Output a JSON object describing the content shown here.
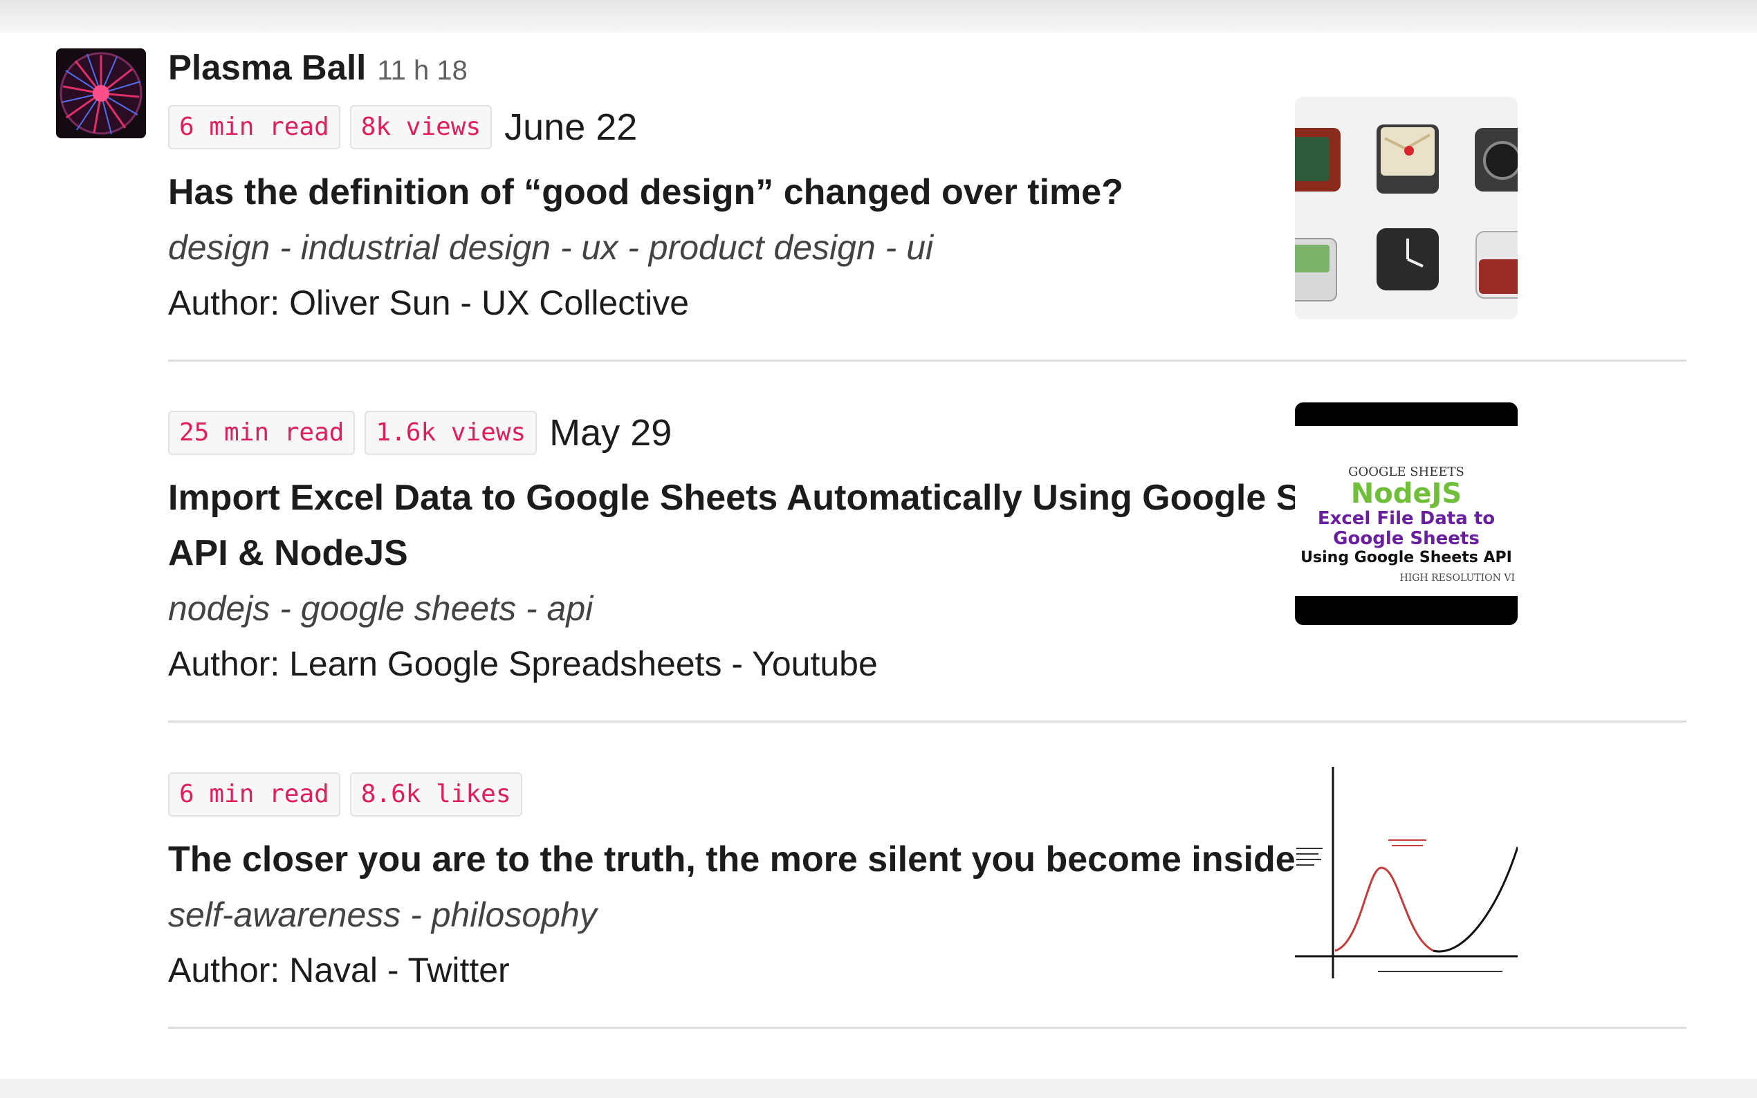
{
  "message": {
    "sender": "Plasma Ball",
    "timestamp": "11 h 18"
  },
  "articles": [
    {
      "read_time": "6 min read",
      "stat": "8k views",
      "date": "June 22",
      "title": "Has the definition of “good design” changed over time?",
      "tags": "design - industrial design - ux - product design - ui",
      "author": "Author: Oliver Sun - UX Collective",
      "thumbnail_icon": "retro-device-icons-thumbnail"
    },
    {
      "read_time": "25 min read",
      "stat": "1.6k views",
      "date": "May 29",
      "title": "Import Excel Data to Google Sheets Automatically Using Google Sheets API & NodeJS",
      "tags": "nodejs - google sheets - api",
      "author": "Author: Learn Google Spreadsheets - Youtube",
      "thumbnail": {
        "line1": "GOOGLE SHEETS",
        "line2": "NodeJS",
        "line3": "Excel File Data to",
        "line4": "Google Sheets",
        "line5": "Using Google Sheets API",
        "line6": "HIGH RESOLUTION VI"
      }
    },
    {
      "read_time": "6 min read",
      "stat": "8.6k likes",
      "date": "",
      "title": "The closer you are to the truth, the more silent you become inside.",
      "tags": "self-awareness - philosophy",
      "author": "Author: Naval - Twitter",
      "thumbnail_icon": "dunning-kruger-curve-thumbnail"
    }
  ],
  "colors": {
    "badge_text": "#e01e5a",
    "badge_bg": "#f7f7f7",
    "text": "#1d1c1d",
    "muted": "#616061"
  }
}
